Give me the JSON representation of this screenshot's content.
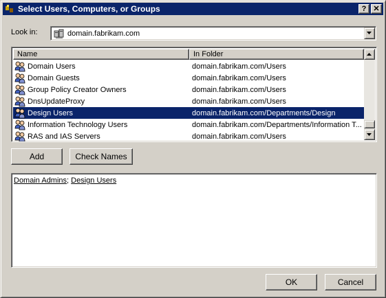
{
  "window": {
    "title": "Select Users, Computers, or Groups",
    "help_label": "?",
    "close_label": "✕",
    "titlebar_color": "#0a246a"
  },
  "lookin": {
    "label": "Look in:",
    "value": "domain.fabrikam.com",
    "icon": "domain-icon"
  },
  "list": {
    "columns": [
      "Name",
      "In Folder"
    ],
    "rows": [
      {
        "name": "Domain Users",
        "folder": "domain.fabrikam.com/Users",
        "icon": "group-icon",
        "selected": false
      },
      {
        "name": "Domain Guests",
        "folder": "domain.fabrikam.com/Users",
        "icon": "group-icon",
        "selected": false
      },
      {
        "name": "Group Policy Creator Owners",
        "folder": "domain.fabrikam.com/Users",
        "icon": "group-icon",
        "selected": false
      },
      {
        "name": "DnsUpdateProxy",
        "folder": "domain.fabrikam.com/Users",
        "icon": "group-icon",
        "selected": false
      },
      {
        "name": "Design Users",
        "folder": "domain.fabrikam.com/Departments/Design",
        "icon": "group-icon",
        "selected": true
      },
      {
        "name": "Information Technology Users",
        "folder": "domain.fabrikam.com/Departments/Information T...",
        "icon": "group-icon",
        "selected": false
      },
      {
        "name": "RAS and IAS Servers",
        "folder": "domain.fabrikam.com/Users",
        "icon": "group-icon",
        "selected": false
      }
    ],
    "selection_color": "#0a246a"
  },
  "buttons": {
    "add": "Add",
    "check_names": "Check Names",
    "ok": "OK",
    "cancel": "Cancel"
  },
  "selected_objects": {
    "items": [
      "Domain Admins",
      "Design Users"
    ],
    "separator": "; "
  }
}
